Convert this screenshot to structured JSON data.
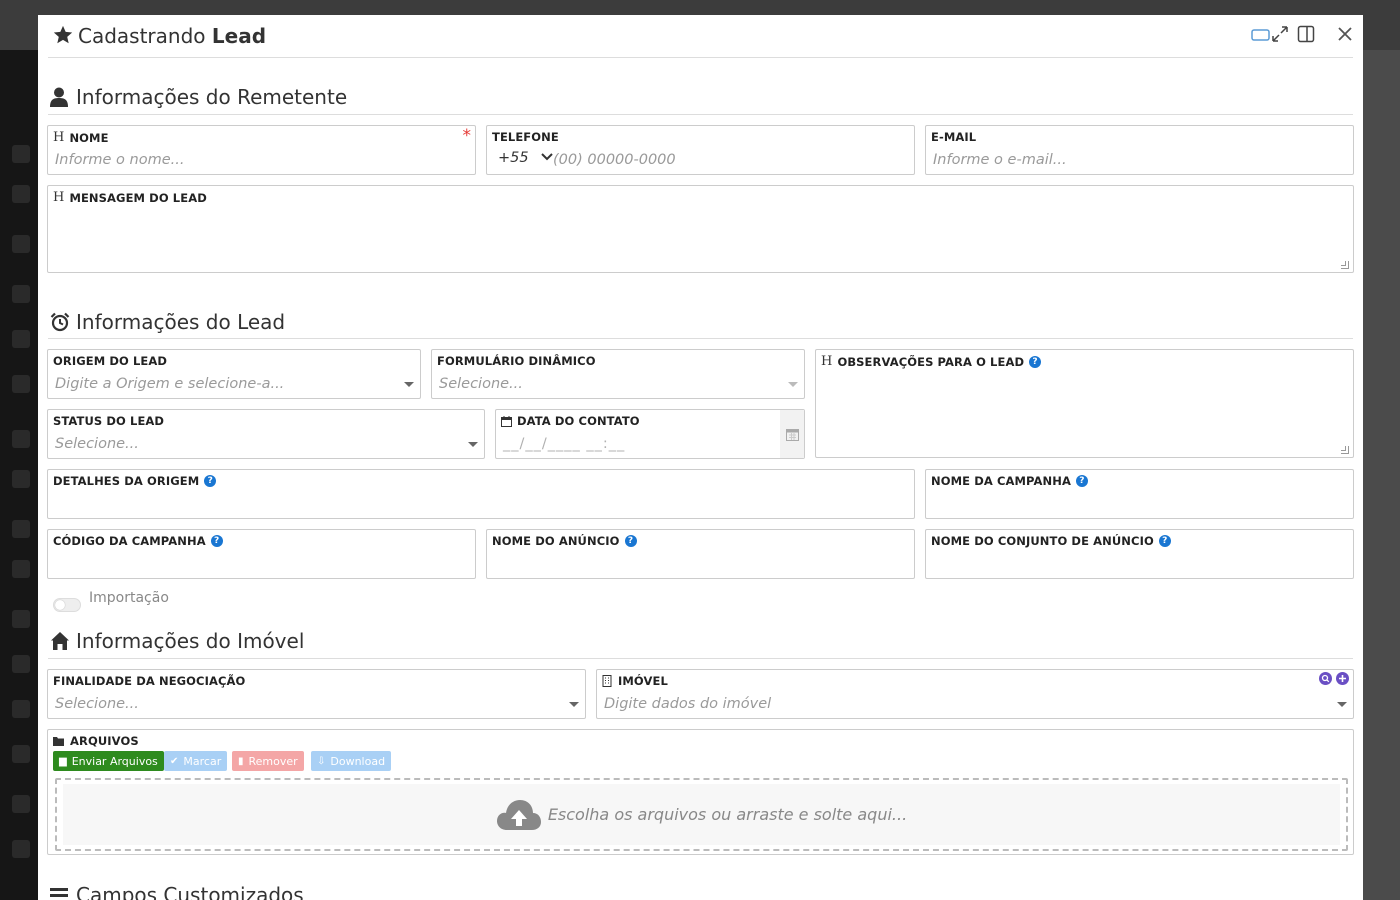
{
  "modal": {
    "title_prefix": "Cadastrando",
    "title_bold": "Lead"
  },
  "sections": {
    "remetente": "Informações do Remetente",
    "lead": "Informações do Lead",
    "imovel": "Informações do Imóvel",
    "custom": "Campos Customizados"
  },
  "fields": {
    "nome": {
      "label": "NOME",
      "placeholder": "Informe o nome...",
      "required": "*"
    },
    "telefone": {
      "label": "TELEFONE",
      "country_code": "+55",
      "placeholder": "(00) 00000-0000"
    },
    "email": {
      "label": "E-MAIL",
      "placeholder": "Informe o e-mail..."
    },
    "mensagem": {
      "label": "MENSAGEM DO LEAD"
    },
    "origem": {
      "label": "ORIGEM DO LEAD",
      "placeholder": "Digite a Origem e selecione-a..."
    },
    "formulario": {
      "label": "FORMULÁRIO DINÂMICO",
      "placeholder": "Selecione..."
    },
    "observacoes": {
      "label": "OBSERVAÇÕES PARA O LEAD"
    },
    "status": {
      "label": "STATUS DO LEAD",
      "placeholder": "Selecione..."
    },
    "data_contato": {
      "label": "DATA DO CONTATO",
      "placeholder": "__/__/____ __:__"
    },
    "detalhes_origem": {
      "label": "DETALHES DA ORIGEM"
    },
    "nome_campanha": {
      "label": "NOME DA CAMPANHA"
    },
    "codigo_campanha": {
      "label": "CÓDIGO DA CAMPANHA"
    },
    "nome_anuncio": {
      "label": "NOME DO ANÚNCIO"
    },
    "conjunto_anuncio": {
      "label": "NOME DO CONJUNTO DE ANÚNCIO"
    },
    "importacao": {
      "label": "Importação",
      "checked": false
    },
    "finalidade": {
      "label": "FINALIDADE DA NEGOCIAÇÃO",
      "placeholder": "Selecione..."
    },
    "imovel": {
      "label": "IMÓVEL",
      "placeholder": "Digite dados do imóvel"
    },
    "arquivos": {
      "label": "ARQUIVOS",
      "buttons": {
        "enviar": "Enviar Arquivos",
        "marcar": "Marcar",
        "remover": "Remover",
        "download": "Download"
      },
      "dropzone_text": "Escolha os arquivos ou arraste e solte aqui..."
    }
  },
  "help_glyph": "?",
  "colors": {
    "help": "#1976d2",
    "enviar": "#2e8b1e",
    "marcar": "#a9d0f5",
    "remover": "#f4a6a6",
    "download": "#a9d0f5",
    "required": "#e53935"
  }
}
